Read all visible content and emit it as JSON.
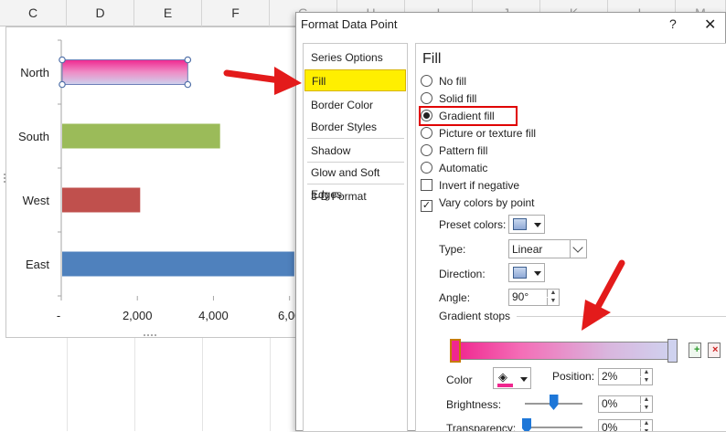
{
  "spreadsheet": {
    "columns": [
      "C",
      "D",
      "E",
      "F",
      "G",
      "H",
      "I",
      "J",
      "K",
      "L",
      "M"
    ]
  },
  "chart_data": {
    "type": "bar",
    "orientation": "horizontal",
    "categories": [
      "North",
      "South",
      "West",
      "East"
    ],
    "values": [
      3300,
      4150,
      2050,
      6100
    ],
    "xlim": [
      0,
      6200
    ],
    "x_ticks": [
      "-",
      "2,000",
      "4,000",
      "6,00"
    ],
    "colors": [
      "#f0278f",
      "#9bbb59",
      "#c0504d",
      "#4f81bd"
    ],
    "selected_category": "North"
  },
  "dialog": {
    "title": "Format Data Point",
    "help": "?",
    "close": "✕",
    "categories": [
      "Series Options",
      "Fill",
      "Border Color",
      "Border Styles",
      "Shadow",
      "Glow and Soft Edges",
      "3-D Format"
    ],
    "selected_category": "Fill",
    "pane": {
      "heading": "Fill",
      "fill_options": [
        {
          "label": "No fill",
          "selected": false
        },
        {
          "label": "Solid fill",
          "selected": false
        },
        {
          "label": "Gradient fill",
          "selected": true
        },
        {
          "label": "Picture or texture fill",
          "selected": false
        },
        {
          "label": "Pattern fill",
          "selected": false
        },
        {
          "label": "Automatic",
          "selected": false
        }
      ],
      "invert_if_negative": {
        "label": "Invert if negative",
        "checked": false
      },
      "vary_colors": {
        "label": "Vary colors by point",
        "checked": true,
        "mark": "✓"
      },
      "preset_colors_label": "Preset colors:",
      "type_label": "Type:",
      "type_value": "Linear",
      "direction_label": "Direction:",
      "angle_label": "Angle:",
      "angle_value": "90°",
      "gradient_stops_label": "Gradient stops",
      "color_label": "Color",
      "position_label": "Position:",
      "position_value": "2%",
      "brightness_label": "Brightness:",
      "brightness_value": "0%",
      "brightness_level": 0.5,
      "transparency_label": "Transparency:",
      "transparency_value": "0%",
      "transparency_level": 0.0
    }
  },
  "colors": {
    "fill_selected": "#ffef00",
    "highlight_box": "#e00000",
    "arrow": "#e31b1b",
    "slider_thumb": "#1e77d8"
  }
}
